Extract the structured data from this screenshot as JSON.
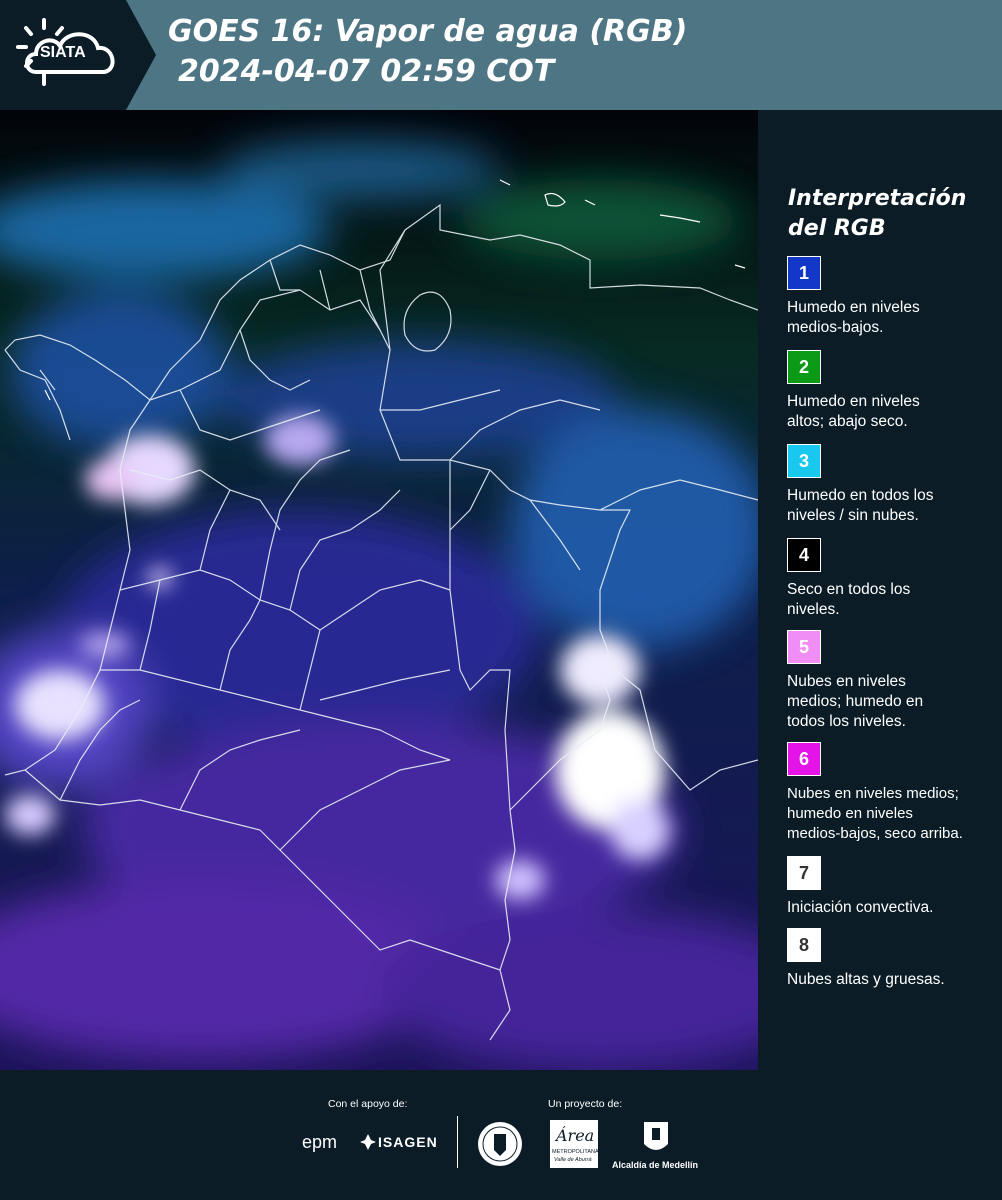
{
  "header": {
    "logo_text": "SIATA",
    "title_line1": "GOES 16: Vapor de agua (RGB)",
    "title_line2": "2024-04-07 02:59 COT"
  },
  "map": {
    "description_name": "goes16-water-vapor-rgb-image",
    "region": "Colombia y Venezuela"
  },
  "legend": {
    "title": "Interpretación del RGB",
    "items": [
      {
        "number": "1",
        "color": "#1237c9",
        "text": "Humedo en niveles\nmedios-bajos."
      },
      {
        "number": "2",
        "color": "#0b9a16",
        "text": "Humedo en niveles\naltos; abajo seco."
      },
      {
        "number": "3",
        "color": "#19c8ef",
        "text": "Humedo en todos los\nniveles / sin nubes."
      },
      {
        "number": "4",
        "color": "#000000",
        "text": "Seco en todos los\nniveles."
      },
      {
        "number": "5",
        "color": "#f08ef5",
        "text": "Nubes en niveles\nmedios; humedo en\ntodos los niveles."
      },
      {
        "number": "6",
        "color": "#e413e8",
        "text": "Nubes en niveles medios;\nhumedo en niveles\nmedios-bajos, seco arriba."
      },
      {
        "number": "7",
        "color": "#ffffff",
        "text": "Iniciación convectiva."
      },
      {
        "number": "8",
        "color": "#ffffff",
        "text": "Nubes altas y gruesas."
      }
    ]
  },
  "footer": {
    "support_label": "Con el apoyo de:",
    "project_label": "Un proyecto de:",
    "sponsors": [
      "epm",
      "ISAGEN"
    ],
    "area_text": "Área",
    "area_subtext": "METROPOLITANA",
    "area_subtext2": "Valle de Aburrá",
    "medellin_label": "Alcaldía de Medellín"
  },
  "colors": {
    "header_bg": "#4d7584",
    "header_dark": "#0b1c26",
    "page_bg": "#0b1c26"
  }
}
